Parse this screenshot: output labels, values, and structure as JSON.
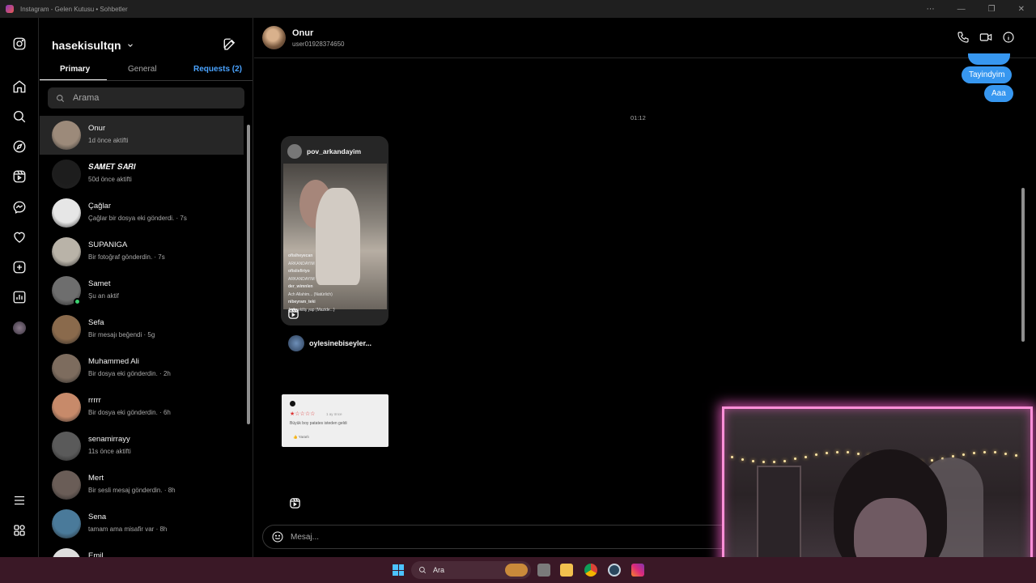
{
  "window": {
    "title": "Instagram - Gelen Kutusu • Sohbetler",
    "controls": [
      "⋯",
      "—",
      "❐",
      "✕"
    ]
  },
  "rail": {
    "icons": [
      "instagram-logo-icon",
      "home-icon",
      "search-icon",
      "explore-icon",
      "reels-icon",
      "messenger-icon",
      "heart-icon",
      "create-icon",
      "dashboard-icon",
      "profile-avatar",
      "menu-icon",
      "apps-icon"
    ]
  },
  "inbox": {
    "username": "hasekisultqn",
    "tabs": {
      "primary": "Primary",
      "general": "General",
      "requests": "Requests (2)"
    },
    "search_placeholder": "Arama",
    "conversations": [
      {
        "name": "Onur",
        "sub": "1d önce aktifti",
        "active": true,
        "avatar_color": "#9c8a7a"
      },
      {
        "name": "𝑺𝑨𝑴𝑬𝑻 𝑺𝑨𝑹𝑰",
        "sub": "50d önce aktifti",
        "avatar_color": "#1d1d1d"
      },
      {
        "name": "Çağlar",
        "sub": "Çağlar bir dosya eki gönderdi. · 7s",
        "avatar_color": "#e6e6e6"
      },
      {
        "name": "SUPANIGA",
        "sub": "Bir fotoğraf gönderdin. · 7s",
        "avatar_color": "#b9b3a8"
      },
      {
        "name": "Samet",
        "sub": "Şu an aktif",
        "online": true,
        "avatar_color": "#6e6e6e"
      },
      {
        "name": "Sefa",
        "sub": "Bir mesajı beğendi · 5g",
        "avatar_color": "#8a6a4c"
      },
      {
        "name": "Muhammed Ali",
        "sub": "Bir dosya eki gönderdin. · 2h",
        "avatar_color": "#7d6c5e"
      },
      {
        "name": "rrrrr",
        "sub": "Bir dosya eki gönderdin. · 6h",
        "avatar_color": "#c78a6a"
      },
      {
        "name": "senamirrayy",
        "sub": "11s önce aktifti",
        "avatar_color": "#5a5a5a"
      },
      {
        "name": "Mert",
        "sub": "Bir sesli mesaj gönderdin. · 8h",
        "avatar_color": "#6a5d57"
      },
      {
        "name": "Sena",
        "sub": "tamam ama misafir var · 8h",
        "avatar_color": "#4a7a9a"
      },
      {
        "name": "Emil",
        "sub": "",
        "avatar_color": "#dddddd"
      }
    ]
  },
  "chat": {
    "contact_name": "Onur",
    "contact_handle": "user01928374650",
    "header_icons": [
      "phone-icon",
      "video-icon",
      "info-icon"
    ],
    "sent_messages": [
      "Tayindyim",
      "Aaa"
    ],
    "timestamp": "01:12",
    "reel": {
      "author": "pov_arkandayim",
      "comments": [
        {
          "user": "ofisiheyecan",
          "text": "ARKANDAYIM"
        },
        {
          "user": "ofisiisfiriyo",
          "text": "ARKANDAYIM"
        },
        {
          "user": "der_wimnlen",
          "text": "Ach Allahim... (Natürlich)"
        },
        {
          "user": "nibeyram_teki",
          "text": "Acil çekiliş yap (Mazide...)"
        }
      ],
      "shared_by": "oylesinebiseyler..."
    },
    "review": {
      "stars": "★☆☆☆☆",
      "meta": "1 ay önce",
      "text": "Büyük boy patates isteden geldi",
      "useful": "Yararlı"
    },
    "composer_placeholder": "Mesaj..."
  },
  "taskbar": {
    "search_label": "Ara",
    "apps": [
      "task-view-icon",
      "file-explorer-icon",
      "chrome-icon",
      "steam-icon",
      "instagram-icon"
    ]
  },
  "colors": {
    "accent_blue": "#3797f0",
    "link_blue": "#4aa3ff",
    "online_green": "#3bd16f",
    "webcam_border": "#ff8fd8"
  }
}
